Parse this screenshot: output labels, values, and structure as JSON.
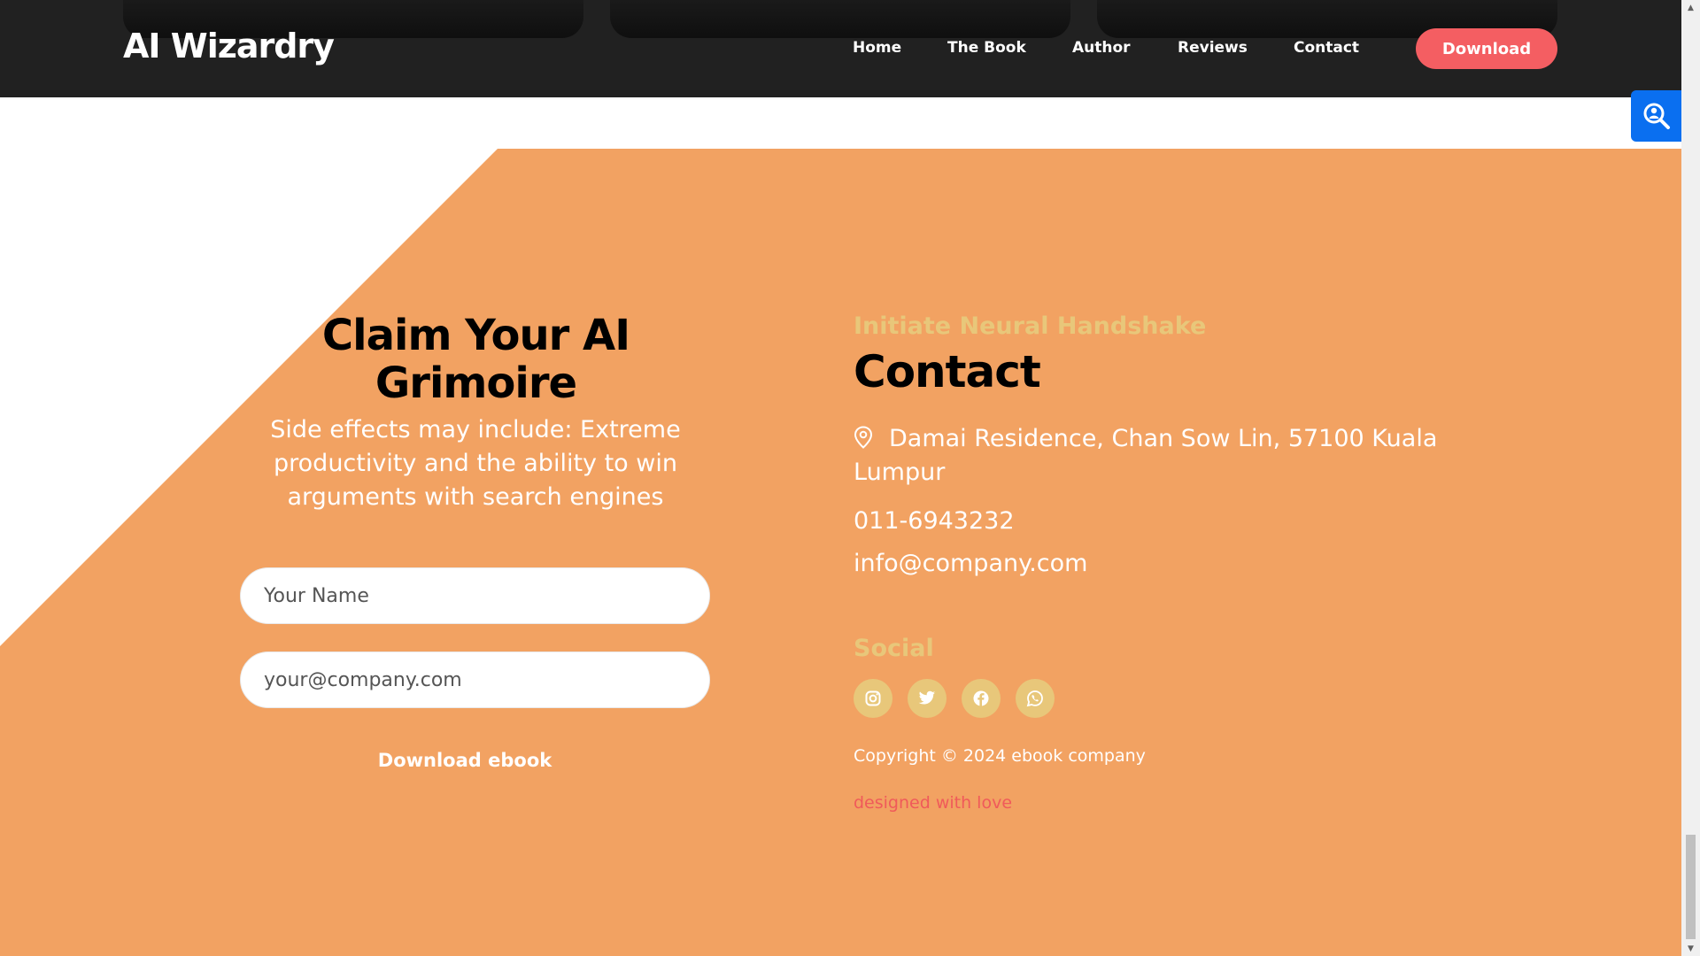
{
  "header": {
    "logo": "AI Wizardry",
    "nav": [
      "Home",
      "The Book",
      "Author",
      "Reviews",
      "Contact"
    ],
    "download_label": "Download"
  },
  "float_button": {
    "icon": "search-person-icon"
  },
  "claim": {
    "title": "Claim Your AI Grimoire",
    "subtitle": "Side effects may include: Extreme productivity and the ability to win arguments with search engines",
    "name_placeholder": "Your Name",
    "email_placeholder": "your@company.com",
    "submit_label": "Download ebook"
  },
  "contact": {
    "eyebrow": "Initiate Neural Handshake",
    "title": "Contact",
    "address": "Damai Residence, Chan Sow Lin, 57100 Kuala Lumpur",
    "phone": "011-6943232",
    "email": "info@company.com",
    "social_title": "Social",
    "social_icons": [
      "instagram-icon",
      "twitter-icon",
      "facebook-icon",
      "whatsapp-icon"
    ],
    "copyright": "Copyright © 2024 ebook company",
    "credit": "designed with love"
  },
  "colors": {
    "header_bg": "#212121",
    "orange": "#f2a262",
    "accent_red": "#f45e62",
    "gold": "#e8c77a",
    "blue": "#0a6ff0"
  }
}
